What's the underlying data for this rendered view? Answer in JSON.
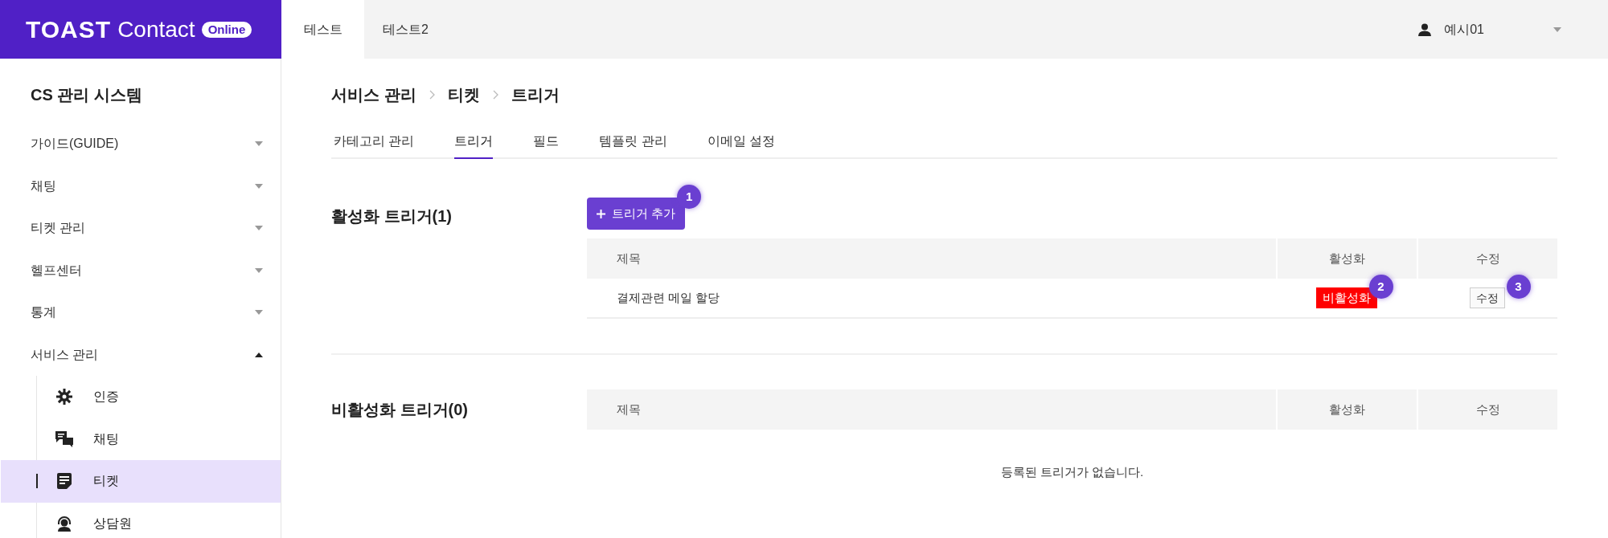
{
  "logo": {
    "brand": "TOAST",
    "product": "Contact",
    "badge": "Online"
  },
  "top_tabs": [
    {
      "label": "테스트",
      "selected": true
    },
    {
      "label": "테스트2",
      "selected": false
    }
  ],
  "user": {
    "name": "예시01"
  },
  "sidebar": {
    "title": "CS 관리 시스템",
    "items": [
      {
        "label": "가이드(GUIDE)",
        "expanded": false
      },
      {
        "label": "채팅",
        "expanded": false
      },
      {
        "label": "티켓 관리",
        "expanded": false
      },
      {
        "label": "헬프센터",
        "expanded": false
      },
      {
        "label": "통계",
        "expanded": false
      },
      {
        "label": "서비스 관리",
        "expanded": true,
        "children": [
          {
            "label": "인증",
            "kind": "gear",
            "selected": false
          },
          {
            "label": "채팅",
            "kind": "chat",
            "selected": false
          },
          {
            "label": "티켓",
            "kind": "ticket",
            "selected": true
          },
          {
            "label": "상담원",
            "kind": "agent",
            "selected": false
          }
        ]
      }
    ]
  },
  "breadcrumb": [
    "서비스 관리",
    "티켓",
    "트리거"
  ],
  "tabs": [
    {
      "label": "카테고리 관리",
      "selected": false
    },
    {
      "label": "트리거",
      "selected": true
    },
    {
      "label": "필드",
      "selected": false
    },
    {
      "label": "템플릿 관리",
      "selected": false
    },
    {
      "label": "이메일 설정",
      "selected": false
    }
  ],
  "active_section": {
    "title": "활성화 트리거(1)",
    "add_button": "트리거 추가",
    "add_marker": "1",
    "columns": [
      "제목",
      "활성화",
      "수정"
    ],
    "rows": [
      {
        "title": "결제관련 메일 할당",
        "toggle": "비활성화",
        "toggle_marker": "2",
        "edit": "수정",
        "edit_marker": "3"
      }
    ]
  },
  "inactive_section": {
    "title": "비활성화 트리거(0)",
    "columns": [
      "제목",
      "활성화",
      "수정"
    ],
    "empty": "등록된 트리거가 없습니다."
  }
}
